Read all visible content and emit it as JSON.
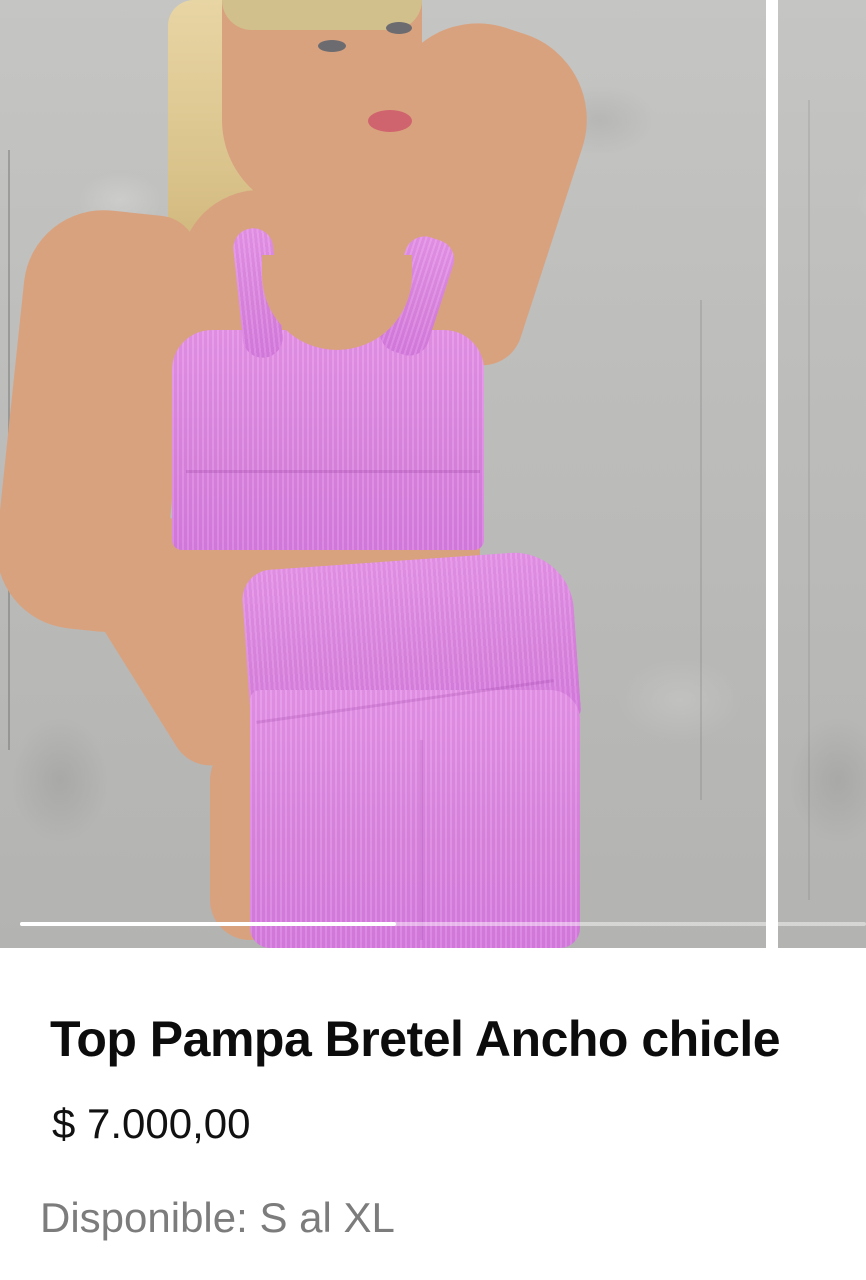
{
  "carousel": {
    "progress": 0.445,
    "slide_count_visible": 2
  },
  "product": {
    "title": "Top Pampa Bretel Ancho chicle",
    "price": "$ 7.000,00",
    "availability": "Disponible: S al XL"
  },
  "colors": {
    "garment": "#db84e0",
    "text_primary": "#0c0c0c",
    "text_secondary": "#7c7c7c",
    "wall": "#bdbdbb"
  },
  "icons": {
    "product_image": "product-photo"
  }
}
